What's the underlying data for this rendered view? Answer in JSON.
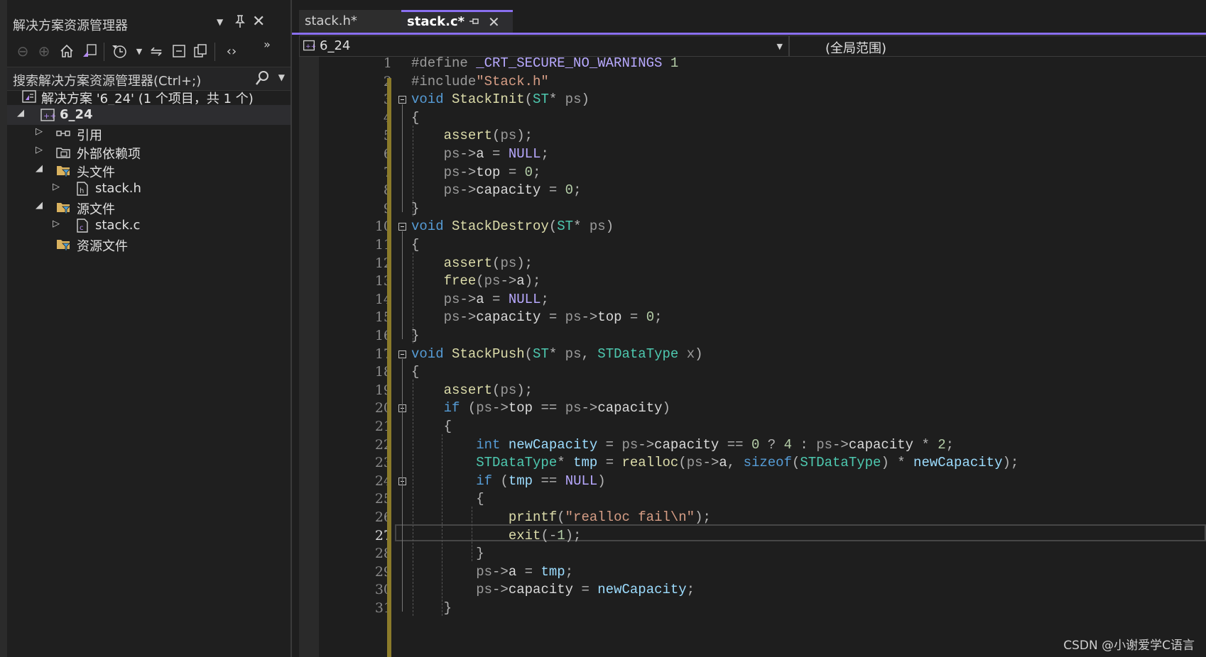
{
  "solution_explorer": {
    "title": "解决方案资源管理器",
    "search_placeholder": "搜索解决方案资源管理器(Ctrl+;)",
    "tree": [
      {
        "label": "解决方案 '6_24' (1 个项目，共 1 个)",
        "icon": "solution-icon"
      },
      {
        "label": "6_24",
        "icon": "cpp-project-icon",
        "selected": true
      },
      {
        "label": "引用",
        "icon": "references-icon"
      },
      {
        "label": "外部依赖项",
        "icon": "external-deps-icon"
      },
      {
        "label": "头文件",
        "icon": "filter-folder-icon"
      },
      {
        "label": "stack.h",
        "icon": "header-file-icon"
      },
      {
        "label": "源文件",
        "icon": "filter-folder-icon"
      },
      {
        "label": "stack.c",
        "icon": "c-file-icon"
      },
      {
        "label": "资源文件",
        "icon": "filter-folder-icon"
      }
    ]
  },
  "editor": {
    "tabs": [
      {
        "label": "stack.h*",
        "active": false
      },
      {
        "label": "stack.c*",
        "active": true
      }
    ],
    "nav_project": "6_24",
    "nav_scope": "(全局范围)",
    "current_line": 27,
    "line_numbers": [
      "1",
      "2",
      "3",
      "4",
      "5",
      "6",
      "7",
      "8",
      "9",
      "10",
      "11",
      "12",
      "13",
      "14",
      "15",
      "16",
      "17",
      "18",
      "19",
      "20",
      "21",
      "22",
      "23",
      "24",
      "25",
      "26",
      "27",
      "28",
      "29",
      "30",
      "31"
    ],
    "lines": [
      [
        [
          "pp",
          "#define "
        ],
        [
          "mc",
          "_CRT_SECURE_NO_WARNINGS"
        ],
        [
          "nm",
          " 1"
        ]
      ],
      [
        [
          "pp",
          "#include"
        ],
        [
          "st",
          "\"Stack.h\""
        ]
      ],
      [
        [
          "k",
          "void"
        ],
        [
          "mb",
          " "
        ],
        [
          "fn",
          "StackInit"
        ],
        [
          "op",
          "("
        ],
        [
          "ty",
          "ST"
        ],
        [
          "op",
          "* "
        ],
        [
          "pa",
          "ps"
        ],
        [
          "op",
          ")"
        ]
      ],
      [
        [
          "op",
          "{"
        ]
      ],
      [
        [
          "mb",
          "    "
        ],
        [
          "fn",
          "assert"
        ],
        [
          "op",
          "("
        ],
        [
          "pa",
          "ps"
        ],
        [
          "op",
          ");"
        ]
      ],
      [
        [
          "mb",
          "    "
        ],
        [
          "pa",
          "ps"
        ],
        [
          "op",
          "->"
        ],
        [
          "mb",
          "a "
        ],
        [
          "op",
          "= "
        ],
        [
          "mc",
          "NULL"
        ],
        [
          "op",
          ";"
        ]
      ],
      [
        [
          "mb",
          "    "
        ],
        [
          "pa",
          "ps"
        ],
        [
          "op",
          "->"
        ],
        [
          "mb",
          "top "
        ],
        [
          "op",
          "= "
        ],
        [
          "nm",
          "0"
        ],
        [
          "op",
          ";"
        ]
      ],
      [
        [
          "mb",
          "    "
        ],
        [
          "pa",
          "ps"
        ],
        [
          "op",
          "->"
        ],
        [
          "mb",
          "capacity "
        ],
        [
          "op",
          "= "
        ],
        [
          "nm",
          "0"
        ],
        [
          "op",
          ";"
        ]
      ],
      [
        [
          "op",
          "}"
        ]
      ],
      [
        [
          "k",
          "void"
        ],
        [
          "mb",
          " "
        ],
        [
          "fn",
          "StackDestroy"
        ],
        [
          "op",
          "("
        ],
        [
          "ty",
          "ST"
        ],
        [
          "op",
          "* "
        ],
        [
          "pa",
          "ps"
        ],
        [
          "op",
          ")"
        ]
      ],
      [
        [
          "op",
          "{"
        ]
      ],
      [
        [
          "mb",
          "    "
        ],
        [
          "fn",
          "assert"
        ],
        [
          "op",
          "("
        ],
        [
          "pa",
          "ps"
        ],
        [
          "op",
          ");"
        ]
      ],
      [
        [
          "mb",
          "    "
        ],
        [
          "fn",
          "free"
        ],
        [
          "op",
          "("
        ],
        [
          "pa",
          "ps"
        ],
        [
          "op",
          "->"
        ],
        [
          "mb",
          "a"
        ],
        [
          "op",
          ");"
        ]
      ],
      [
        [
          "mb",
          "    "
        ],
        [
          "pa",
          "ps"
        ],
        [
          "op",
          "->"
        ],
        [
          "mb",
          "a "
        ],
        [
          "op",
          "= "
        ],
        [
          "mc",
          "NULL"
        ],
        [
          "op",
          ";"
        ]
      ],
      [
        [
          "mb",
          "    "
        ],
        [
          "pa",
          "ps"
        ],
        [
          "op",
          "->"
        ],
        [
          "mb",
          "capacity "
        ],
        [
          "op",
          "= "
        ],
        [
          "pa",
          "ps"
        ],
        [
          "op",
          "->"
        ],
        [
          "mb",
          "top "
        ],
        [
          "op",
          "= "
        ],
        [
          "nm",
          "0"
        ],
        [
          "op",
          ";"
        ]
      ],
      [
        [
          "op",
          "}"
        ]
      ],
      [
        [
          "k",
          "void"
        ],
        [
          "mb",
          " "
        ],
        [
          "fn",
          "StackPush"
        ],
        [
          "op",
          "("
        ],
        [
          "ty",
          "ST"
        ],
        [
          "op",
          "* "
        ],
        [
          "pa",
          "ps"
        ],
        [
          "op",
          ", "
        ],
        [
          "ty",
          "STDataType"
        ],
        [
          "mb",
          " "
        ],
        [
          "pa",
          "x"
        ],
        [
          "op",
          ")"
        ]
      ],
      [
        [
          "op",
          "{"
        ]
      ],
      [
        [
          "mb",
          "    "
        ],
        [
          "fn",
          "assert"
        ],
        [
          "op",
          "("
        ],
        [
          "pa",
          "ps"
        ],
        [
          "op",
          ");"
        ]
      ],
      [
        [
          "mb",
          "    "
        ],
        [
          "k",
          "if"
        ],
        [
          "mb",
          " "
        ],
        [
          "op",
          "("
        ],
        [
          "pa",
          "ps"
        ],
        [
          "op",
          "->"
        ],
        [
          "mb",
          "top "
        ],
        [
          "op",
          "== "
        ],
        [
          "pa",
          "ps"
        ],
        [
          "op",
          "->"
        ],
        [
          "mb",
          "capacity"
        ],
        [
          "op",
          ")"
        ]
      ],
      [
        [
          "mb",
          "    "
        ],
        [
          "op",
          "{"
        ]
      ],
      [
        [
          "mb",
          "        "
        ],
        [
          "k",
          "int"
        ],
        [
          "mb",
          " "
        ],
        [
          "va",
          "newCapacity"
        ],
        [
          "mb",
          " "
        ],
        [
          "op",
          "= "
        ],
        [
          "pa",
          "ps"
        ],
        [
          "op",
          "->"
        ],
        [
          "mb",
          "capacity "
        ],
        [
          "op",
          "== "
        ],
        [
          "nm",
          "0"
        ],
        [
          "op",
          " ? "
        ],
        [
          "nm",
          "4"
        ],
        [
          "op",
          " : "
        ],
        [
          "pa",
          "ps"
        ],
        [
          "op",
          "->"
        ],
        [
          "mb",
          "capacity "
        ],
        [
          "op",
          "* "
        ],
        [
          "nm",
          "2"
        ],
        [
          "op",
          ";"
        ]
      ],
      [
        [
          "mb",
          "        "
        ],
        [
          "ty",
          "STDataType"
        ],
        [
          "op",
          "* "
        ],
        [
          "va",
          "tmp"
        ],
        [
          "mb",
          " "
        ],
        [
          "op",
          "= "
        ],
        [
          "fn",
          "realloc"
        ],
        [
          "op",
          "("
        ],
        [
          "pa",
          "ps"
        ],
        [
          "op",
          "->"
        ],
        [
          "mb",
          "a"
        ],
        [
          "op",
          ", "
        ],
        [
          "k",
          "sizeof"
        ],
        [
          "op",
          "("
        ],
        [
          "ty",
          "STDataType"
        ],
        [
          "op",
          ") * "
        ],
        [
          "va",
          "newCapacity"
        ],
        [
          "op",
          ");"
        ]
      ],
      [
        [
          "mb",
          "        "
        ],
        [
          "k",
          "if"
        ],
        [
          "mb",
          " "
        ],
        [
          "op",
          "("
        ],
        [
          "va",
          "tmp"
        ],
        [
          "mb",
          " "
        ],
        [
          "op",
          "== "
        ],
        [
          "mc",
          "NULL"
        ],
        [
          "op",
          ")"
        ]
      ],
      [
        [
          "mb",
          "        "
        ],
        [
          "op",
          "{"
        ]
      ],
      [
        [
          "mb",
          "            "
        ],
        [
          "fn",
          "printf"
        ],
        [
          "op",
          "("
        ],
        [
          "st",
          "\"realloc fail\\n\""
        ],
        [
          "op",
          ");"
        ]
      ],
      [
        [
          "mb",
          "            "
        ],
        [
          "fn",
          "exit"
        ],
        [
          "op",
          "("
        ],
        [
          "op",
          "-"
        ],
        [
          "nm",
          "1"
        ],
        [
          "op",
          ");"
        ]
      ],
      [
        [
          "mb",
          "        "
        ],
        [
          "op",
          "}"
        ]
      ],
      [
        [
          "mb",
          "        "
        ],
        [
          "pa",
          "ps"
        ],
        [
          "op",
          "->"
        ],
        [
          "mb",
          "a "
        ],
        [
          "op",
          "= "
        ],
        [
          "va",
          "tmp"
        ],
        [
          "op",
          ";"
        ]
      ],
      [
        [
          "mb",
          "        "
        ],
        [
          "pa",
          "ps"
        ],
        [
          "op",
          "->"
        ],
        [
          "mb",
          "capacity "
        ],
        [
          "op",
          "= "
        ],
        [
          "va",
          "newCapacity"
        ],
        [
          "op",
          ";"
        ]
      ],
      [
        [
          "mb",
          "    "
        ],
        [
          "op",
          "}"
        ]
      ]
    ]
  },
  "watermark": "CSDN @小谢爱学C语言",
  "colors": {
    "accent": "#8a6ff0",
    "keyword": "#569cd6",
    "function": "#dcdcaa",
    "type": "#4ec9b0",
    "string": "#d69d85",
    "number": "#b5cea8",
    "macro": "#b8a9ff",
    "change_bar": "#8b7b2a"
  }
}
